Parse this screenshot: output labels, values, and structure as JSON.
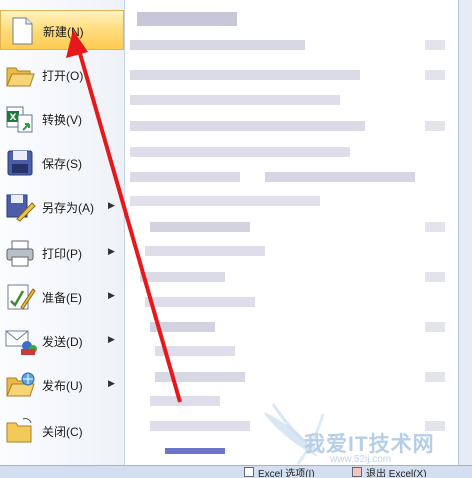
{
  "menu": {
    "items": [
      {
        "label": "新建(N)",
        "icon": "new-document-icon",
        "submenu": false,
        "selected": true
      },
      {
        "label": "打开(O)",
        "icon": "open-folder-icon",
        "submenu": false
      },
      {
        "label": "转换(V)",
        "icon": "convert-icon",
        "submenu": false
      },
      {
        "label": "保存(S)",
        "icon": "save-disk-icon",
        "submenu": false
      },
      {
        "label": "另存为(A)",
        "icon": "save-as-icon",
        "submenu": true
      },
      {
        "label": "打印(P)",
        "icon": "printer-icon",
        "submenu": true
      },
      {
        "label": "准备(E)",
        "icon": "prepare-icon",
        "submenu": true
      },
      {
        "label": "发送(D)",
        "icon": "send-icon",
        "submenu": true
      },
      {
        "label": "发布(U)",
        "icon": "publish-icon",
        "submenu": true
      },
      {
        "label": "关闭(C)",
        "icon": "close-folder-icon",
        "submenu": false
      }
    ]
  },
  "bottom_bar": {
    "options_label": "Excel 选项(I)",
    "exit_label": "退出 Excel(X)"
  },
  "watermark": {
    "text": "我爱IT技术网",
    "url": "www.52ij.com"
  },
  "colors": {
    "highlight": "#ffdb7a",
    "arrow": "#e8171a"
  }
}
